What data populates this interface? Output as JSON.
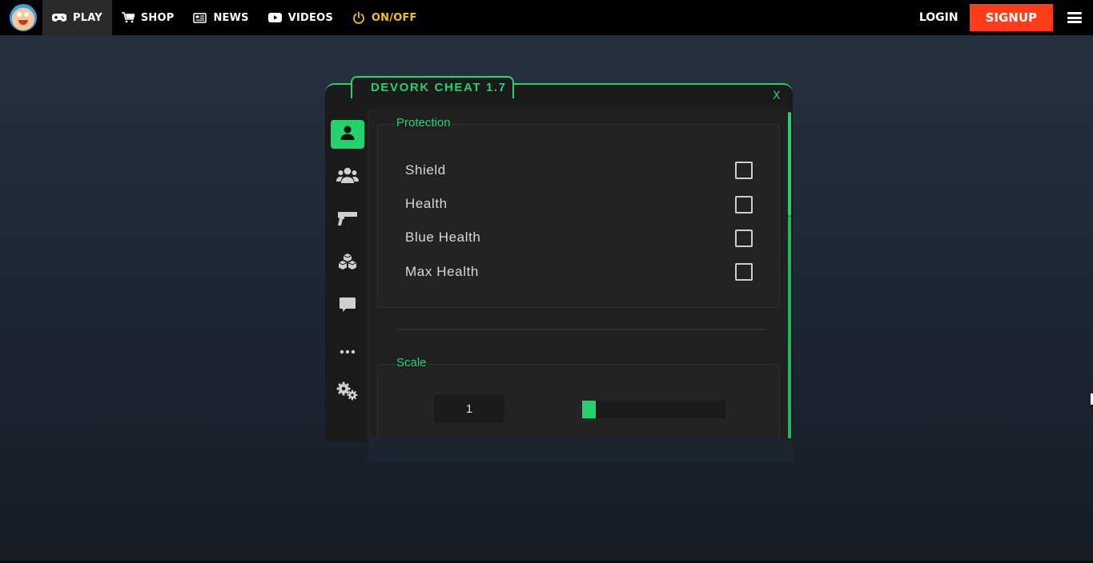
{
  "nav": {
    "items": [
      {
        "label": "PLAY",
        "icon": "gamepad-icon",
        "active": true
      },
      {
        "label": "SHOP",
        "icon": "cart-icon"
      },
      {
        "label": "NEWS",
        "icon": "newspaper-icon"
      },
      {
        "label": "VIDEOS",
        "icon": "youtube-icon"
      },
      {
        "label": "ON/OFF",
        "icon": "power-icon",
        "color": "#f0c419"
      }
    ],
    "login_label": "LOGIN",
    "signup_label": "SIGNUP",
    "signup_color": "#ff3b1a"
  },
  "panel": {
    "title": "DEVORK CHEAT 1.7",
    "close_label": "X",
    "accent_color": "#22d36b",
    "sidebar_icons": [
      "user-icon",
      "users-icon",
      "gun-icon",
      "cubes-icon",
      "chat-icon",
      "more-icon",
      "gears-icon"
    ],
    "sidebar_active": 0,
    "protection": {
      "label": "Protection",
      "options": [
        {
          "label": "Shield",
          "checked": false
        },
        {
          "label": "Health",
          "checked": false
        },
        {
          "label": "Blue Health",
          "checked": false
        },
        {
          "label": "Max Health",
          "checked": false
        }
      ]
    },
    "scale": {
      "label": "Scale",
      "value": "1",
      "slider_fraction": 0
    }
  }
}
